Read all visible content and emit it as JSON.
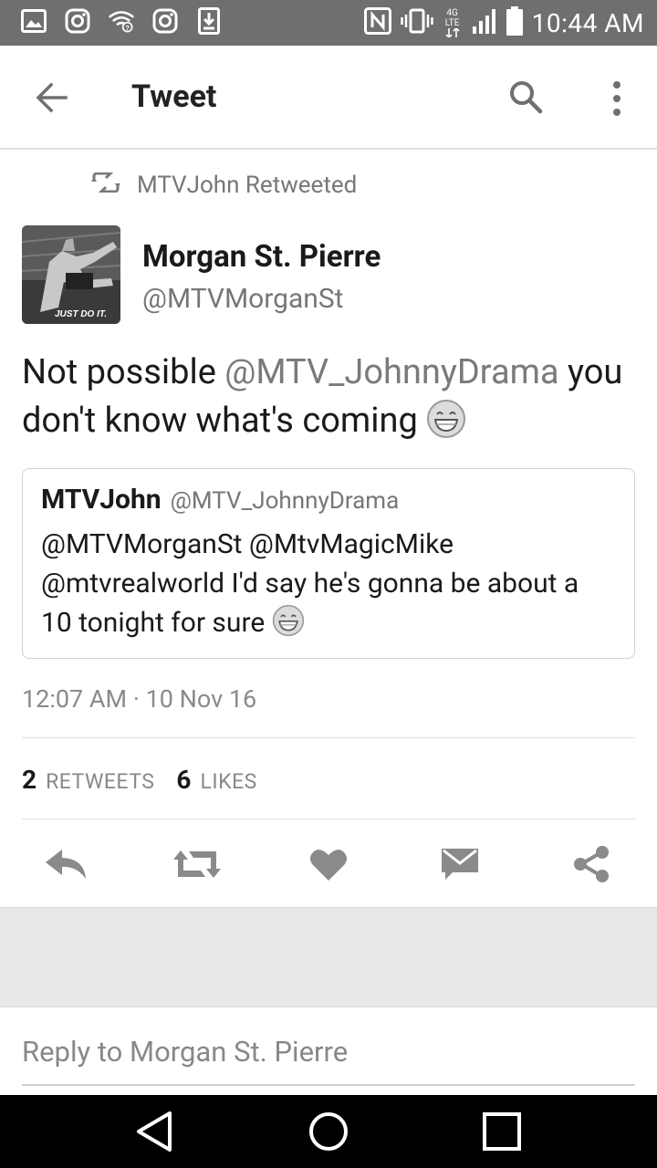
{
  "status_bar": {
    "time": "10:44 AM",
    "network": "4G LTE",
    "icons_left": [
      "gallery-icon",
      "instagram-icon",
      "wifi-icon",
      "instagram-icon",
      "download-icon"
    ],
    "icons_right": [
      "nfc-icon",
      "vibrate-icon",
      "signal-icon",
      "battery-icon"
    ]
  },
  "app_bar": {
    "title": "Tweet",
    "back_icon": "arrow-left-icon",
    "search_icon": "search-icon",
    "more_icon": "more-vert-icon"
  },
  "retweet_context": {
    "label": "MTVJohn Retweeted"
  },
  "tweet": {
    "author_name": "Morgan St. Pierre",
    "author_handle": "@MTVMorganSt",
    "avatar_caption": "JUST DO IT.",
    "text_prefix": "Not possible ",
    "text_mention": "@MTV_JohnnyDrama",
    "text_suffix": " you don't know what's coming",
    "timestamp": "12:07 AM · 10 Nov 16",
    "retweet_count": "2",
    "retweet_label": "RETWEETS",
    "like_count": "6",
    "like_label": "LIKES"
  },
  "quoted_tweet": {
    "name": "MTVJohn",
    "handle": "@MTV_JohnnyDrama",
    "text": "@MTVMorganSt @MtvMagicMike @mtvrealworld I'd say he's gonna be about a 10 tonight for sure"
  },
  "actions": [
    "reply-icon",
    "retweet-icon",
    "like-icon",
    "direct-message-icon",
    "share-icon"
  ],
  "reply": {
    "placeholder": "Reply to Morgan St. Pierre"
  },
  "nav_bar": [
    "back-triangle-icon",
    "home-circle-icon",
    "recents-square-icon"
  ],
  "colors": {
    "status_bar_bg": "#6f6f6f",
    "text_primary": "#1a1a1a",
    "text_secondary": "#777777",
    "icon_gray": "#8a8a8a",
    "gray_area": "#e8e8e8",
    "nav_bar_bg": "#000000"
  }
}
